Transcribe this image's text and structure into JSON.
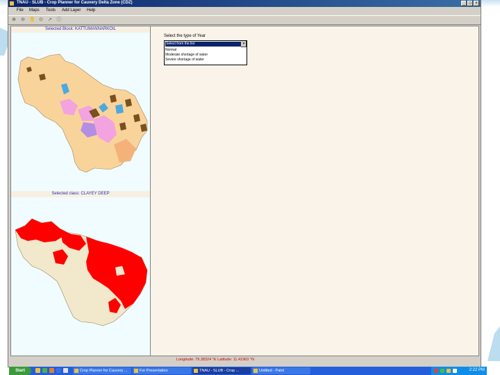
{
  "window": {
    "title": "TNAU - SLUB - Crop Planner for Cauvery Delta Zone (CDZ)",
    "minimize_glyph": "_",
    "maximize_glyph": "□",
    "close_glyph": "×"
  },
  "menu": [
    "File",
    "Maps",
    "Tools",
    "Add Layer",
    "Help"
  ],
  "toolbar_icons": [
    "zoom-in-icon",
    "zoom-out-icon",
    "pan-icon",
    "full-extent-icon",
    "identify-icon",
    "info-icon"
  ],
  "left_panel": {
    "selected_block": "Selected Block:  KATTUMANNARKOIL",
    "selected_class": "Selected class:  CLAYEY DEEP"
  },
  "right_panel": {
    "water_label": "Select the type of Year",
    "dropdown": {
      "selected": "Select from the list",
      "options": [
        "Normal",
        "Moderate shortage of water",
        "Severe shortage of water"
      ]
    }
  },
  "status": {
    "coordinates": "Longitude: 79.38324 °E   Latitude: 11.41963 °N"
  },
  "taskbar": {
    "start": "Start",
    "tasks": [
      "Crop Planner for Cauvery ...",
      "For Presentation",
      "TNAU - SLUB - Crop ...",
      "Untitled - Paint"
    ],
    "clock": "2:22 PM"
  },
  "colors": {
    "titlebar": "#0a246a",
    "map_tan": "#f9d49a",
    "map_red": "#ff0000",
    "map_cream": "#f2e8cc",
    "header_text": "#2a2ab0",
    "coord_text": "#cc0000"
  }
}
